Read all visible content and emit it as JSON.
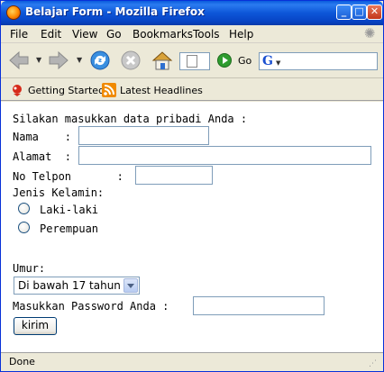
{
  "window": {
    "title": "Belajar Form - Mozilla Firefox",
    "controls": [
      "_",
      "□",
      "✕"
    ]
  },
  "menu": [
    "File",
    "Edit",
    "View",
    "Go",
    "Bookmarks",
    "Tools",
    "Help"
  ],
  "toolbar": {
    "go_label": "Go",
    "search_engine_letter": "G"
  },
  "bookmarks": [
    {
      "label": "Getting Started",
      "icon": "getting-started-icon"
    },
    {
      "label": "Latest Headlines",
      "icon": "rss-feed-icon"
    }
  ],
  "form": {
    "intro": "Silakan masukkan data pribadi Anda :",
    "nama_label": "Nama    :",
    "alamat_label": "Alamat  :",
    "telpon_label": "No Telpon       :",
    "gender_label": "Jenis Kelamin:",
    "gender_options": [
      "Laki-laki",
      "Perempuan"
    ],
    "umur_label": "Umur:",
    "umur_selected": "Di bawah 17 tahun",
    "password_label": "Masukkan Password Anda :",
    "submit_label": "kirim",
    "nama_value": "",
    "alamat_value": "",
    "telpon_value": "",
    "password_value": ""
  },
  "status": {
    "text": "Done"
  },
  "colors": {
    "titlebar": "#0a5bdc",
    "chrome": "#ece9d8",
    "input_border": "#7f9db9"
  }
}
